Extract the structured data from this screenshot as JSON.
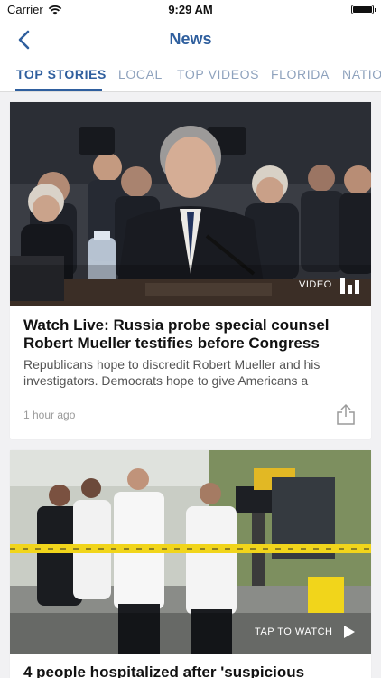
{
  "status_bar": {
    "carrier": "Carrier",
    "time": "9:29 AM"
  },
  "nav": {
    "title": "News",
    "back_icon": "chevron-left-icon"
  },
  "tabs": [
    {
      "label": "TOP STORIES",
      "active": true
    },
    {
      "label": "LOCAL",
      "active": false
    },
    {
      "label": "TOP VIDEOS",
      "active": false
    },
    {
      "label": "FLORIDA",
      "active": false
    },
    {
      "label": "NATIO",
      "active": false
    }
  ],
  "colors": {
    "accent": "#2f5f9e",
    "inactive_tab": "#8ea2bd",
    "background": "#f1f1f3"
  },
  "stories": [
    {
      "media_badge": "VIDEO",
      "media_icon": "bars-icon",
      "headline": "Watch Live: Russia probe special counsel Robert Mueller testifies before Congress",
      "summary": "Republicans hope to discredit Robert Mueller and his investigators. Democrats hope to give Americans a chance...",
      "time_ago": "1 hour ago",
      "share_icon": "share-icon"
    },
    {
      "media_badge": "TAP TO WATCH",
      "media_icon": "play-icon",
      "headline": "4 people hospitalized after 'suspicious"
    }
  ]
}
